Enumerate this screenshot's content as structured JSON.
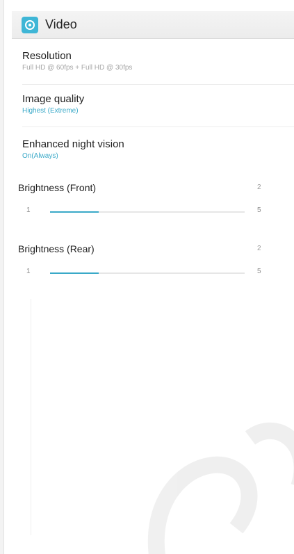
{
  "header": {
    "title": "Video",
    "icon": "video-settings-icon",
    "icon_color": "#3fb6d6"
  },
  "settings": [
    {
      "title": "Resolution",
      "summary": "Full HD @ 60fps + Full HD @ 30fps"
    },
    {
      "title": "Image quality",
      "summary": "Highest (Extreme)"
    },
    {
      "title": "Enhanced night vision",
      "summary": "On(Always)"
    }
  ],
  "sliders": [
    {
      "label": "Brightness (Front)",
      "value": "2",
      "min": "1",
      "max": "5",
      "level": 0.25
    },
    {
      "label": "Brightness (Rear)",
      "value": "2",
      "min": "1",
      "max": "5",
      "level": 0.25
    }
  ],
  "colors": {
    "accent": "#3aa9c8",
    "watermark": "#000000"
  }
}
